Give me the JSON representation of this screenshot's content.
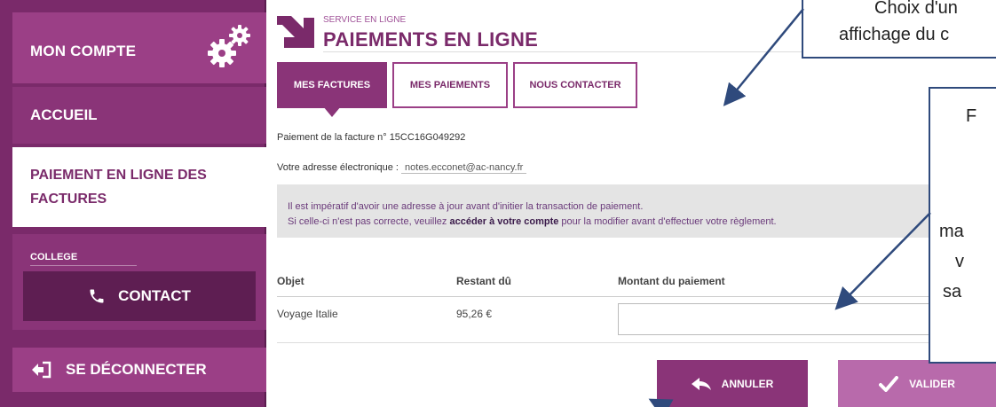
{
  "sidebar": {
    "account_label": "MON COMPTE",
    "home_label": "ACCUEIL",
    "payment_label": "PAIEMENT EN LIGNE DES FACTURES",
    "college_label": "COLLEGE",
    "contact_label": "CONTACT",
    "logout_label": "SE DÉCONNECTER"
  },
  "header": {
    "service_label": "SERVICE EN LIGNE",
    "title": "PAIEMENTS EN LIGNE"
  },
  "tabs": [
    {
      "label": "MES FACTURES",
      "active": true
    },
    {
      "label": "MES PAIEMENTS",
      "active": false
    },
    {
      "label": "NOUS CONTACTER",
      "active": false
    }
  ],
  "invoice": {
    "line": "Paiement de la facture n° 15CC16G049292",
    "email_label": "Votre adresse électronique :",
    "email_value": "notes.ecconet@ac-nancy.fr"
  },
  "notice": {
    "line1": "Il est impératif d'avoir une adresse à jour avant d'initier la transaction de paiement.",
    "line2_before": "Si celle-ci n'est pas correcte, veuillez",
    "line2_link": "accéder à votre compte",
    "line2_after": "pour la modifier avant d'effectuer votre règlement."
  },
  "table": {
    "headers": [
      "Objet",
      "Restant dû",
      "Montant du paiement"
    ],
    "rows": [
      {
        "object": "Voyage Italie",
        "remaining": "95,26 €",
        "amount": ""
      }
    ]
  },
  "buttons": {
    "cancel_label": "ANNULER",
    "validate_label": "VALIDER"
  },
  "annotations": {
    "callout1_line1": "Choix d'un",
    "callout1_line2": "affichage du c",
    "callout2_lines": [
      "F",
      "ma",
      "v",
      "sa"
    ]
  },
  "colors": {
    "brand_dark": "#7a2a6a",
    "brand": "#8a3478",
    "brand_light": "#b86aab",
    "callout_border": "#2f4a7c"
  }
}
